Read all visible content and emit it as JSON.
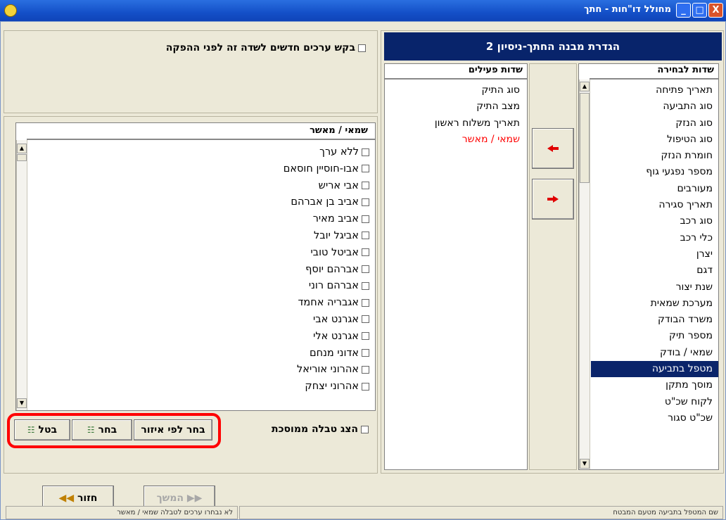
{
  "window": {
    "title": "מחולל דו\"חות - חתך"
  },
  "titlebar_buttons": {
    "minimize": "_",
    "maximize": "□",
    "close": "X"
  },
  "structure_header": "הגדרת מבנה החתך-ניסיון 2",
  "available_fields": {
    "header": "שדות לבחירה",
    "items": [
      "תאריך פתיחה",
      "סוג התביעה",
      "סוג הנזק",
      "סוג הטיפול",
      "חומרת הנזק",
      "מספר נפגעי גוף",
      "מעורבים",
      "תאריך סגירה",
      "סוג רכב",
      "כלי רכב",
      "יצרן",
      "דגם",
      "שנת יצור",
      "מערכת שמאית",
      "משרד הבודק",
      "מספר תיק",
      "שמאי / בודק",
      "מטפל בתביעה",
      "מוסך מתקן",
      "לקוח שכ\"ט",
      "שכ\"ט סגור"
    ],
    "selected": "מטפל בתביעה"
  },
  "active_fields": {
    "header": "שדות פעילים",
    "items": [
      "סוג התיק",
      "מצב התיק",
      "תאריך משלוח ראשון",
      "שמאי / מאשר"
    ],
    "highlighted": "שמאי / מאשר"
  },
  "arrows": {
    "add": "add-arrow-icon",
    "remove": "remove-arrow-icon"
  },
  "request_new_values_label": "בקש ערכים חדשים לשדה זה לפני ההפקה",
  "values_list": {
    "header": "שמאי / מאשר",
    "items": [
      "ללא ערך",
      "אבו-חוסיין חוסאם",
      "אבי אריש",
      "אביב בן אברהם",
      "אביב מאיר",
      "אביגל יובל",
      "אביטל טובי",
      "אברהם יוסף",
      "אברהם רוני",
      "אגבריה אחמד",
      "אגרנט אבי",
      "אגרנט אלי",
      "אדוני מנחם",
      "אהרוני אוריאל",
      "אהרוני יצחק"
    ]
  },
  "show_nested_table_label": "הצג טבלה ממוסכת",
  "buttons": {
    "select_by_region": "בחר לפי איזור",
    "select": "בחר",
    "cancel": "בטל",
    "back": "חזור",
    "next": "המשך"
  },
  "status": {
    "left": "לא נבחרו ערכים לטבלה שמאי / מאשר",
    "right": "שם המטפל בתביעה מטעם המבטח"
  },
  "colors": {
    "highlight_red": "#ff0000",
    "selection_blue": "#0a246a",
    "annotation_red": "#ff0000"
  }
}
